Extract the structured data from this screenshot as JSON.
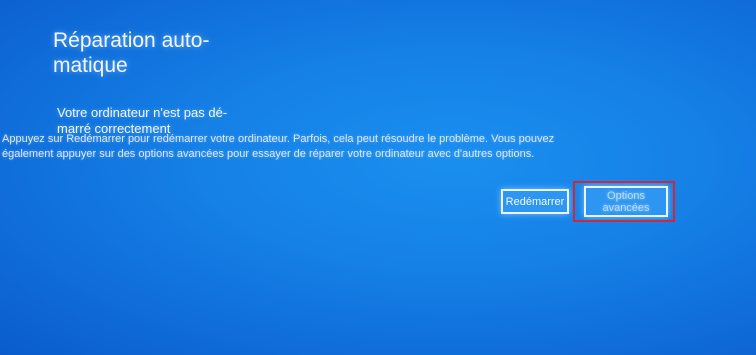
{
  "screen": {
    "title": "Réparation auto-\nmatique",
    "subtitle": "Votre ordinateur n'est pas dé-\nmarré correctement",
    "description_line1": "Appuyez sur Redémarrer pour redémarrer votre ordinateur. Parfois, cela peut résoudre le problème. Vous pouvez",
    "description_line2": "également appuyer sur des options avancées pour essayer de réparer votre ordinateur avec d'autres options."
  },
  "buttons": {
    "restart_label": "Redémarrer",
    "advanced_label_line1": "Options",
    "advanced_label_line2": "avancées"
  },
  "colors": {
    "background": "#1580e6",
    "highlight": "#d0283a"
  }
}
